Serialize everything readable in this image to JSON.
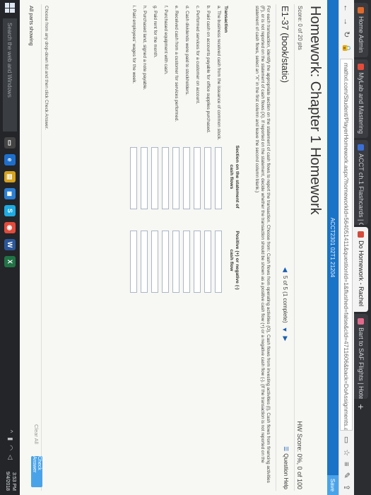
{
  "browser": {
    "tabs": [
      {
        "label": "Home Admin",
        "color": "#e06a2b"
      },
      {
        "label": "MyLab and Mastering",
        "color": "#e34b3b"
      },
      {
        "label": "ACCT ch.1 Flashcards | Quiz",
        "color": "#3b6fd4"
      },
      {
        "label": "Do Homework - Rachel",
        "color": "#d44a3b",
        "active": true
      },
      {
        "label": "Bart to SAF Flights | Hotels",
        "color": "#e06a8b"
      }
    ],
    "url": "mathxl.com/Student/PlayerHomework.aspx?homeworkId=564051411&questionId=1&flushed=false&cId=4711606&back=DoAssignments.aspx"
  },
  "site": {
    "course": "ACCT2301 02T1 21204",
    "side_label": "Save"
  },
  "page": {
    "title": "Homework: Chapter 1 Homework",
    "score": "Score: 0 of 20 pts",
    "hw_score": "HW Score: 0%, 0 of 100",
    "question_id": "E1-37 (book/static)",
    "pager": "5 of 5 (1 complete)",
    "question_help": "Question Help",
    "instructions": "For each transaction, identify the appropriate section on the statement of cash flows to report the transaction. Choose from: Cash flows from operating activities (O), Cash flows from investing activities (I), Cash flows from financing activities (F), or is not reported on the statement of cash flows (X). If reported on the statement, decide whether the transaction should be shown as a positive cash flow (+) or a negative cash flow (-). (If the transaction is not reported on the statement of cash flows, select an \"X\" in the first column and leave the second column blank.)"
  },
  "table": {
    "col_transaction": "Transaction",
    "col_section": "Section on the statement of cash flows",
    "col_sign": "Positive (+) or negative (-) cash flow",
    "rows": [
      {
        "letter": "a.",
        "text": "The business received cash from the issuance of common stock."
      },
      {
        "letter": "b.",
        "text": "Paid cash on accounts payable for office supplies purchased."
      },
      {
        "letter": "c.",
        "text": "Performed services for a customer on account."
      },
      {
        "letter": "d.",
        "text": "Cash dividends were paid to stockholders."
      },
      {
        "letter": "e.",
        "text": "Received cash from a customer for services performed."
      },
      {
        "letter": "f.",
        "text": "Purchased equipment with cash."
      },
      {
        "letter": "g.",
        "text": "Paid rent for the month."
      },
      {
        "letter": "h.",
        "text": "Purchased land, signed a note payable."
      },
      {
        "letter": "i.",
        "text": "Paid employees' wages for the week."
      }
    ]
  },
  "footer": {
    "hint": "Choose from any drop-down list and then click Check Answer.",
    "parts": "All parts showing",
    "clear_all": "Clear All",
    "check_answer": "Check Answer"
  },
  "taskbar": {
    "search_placeholder": "Search the web and Windows",
    "time": "3:53 PM",
    "date": "9/4/2018"
  }
}
